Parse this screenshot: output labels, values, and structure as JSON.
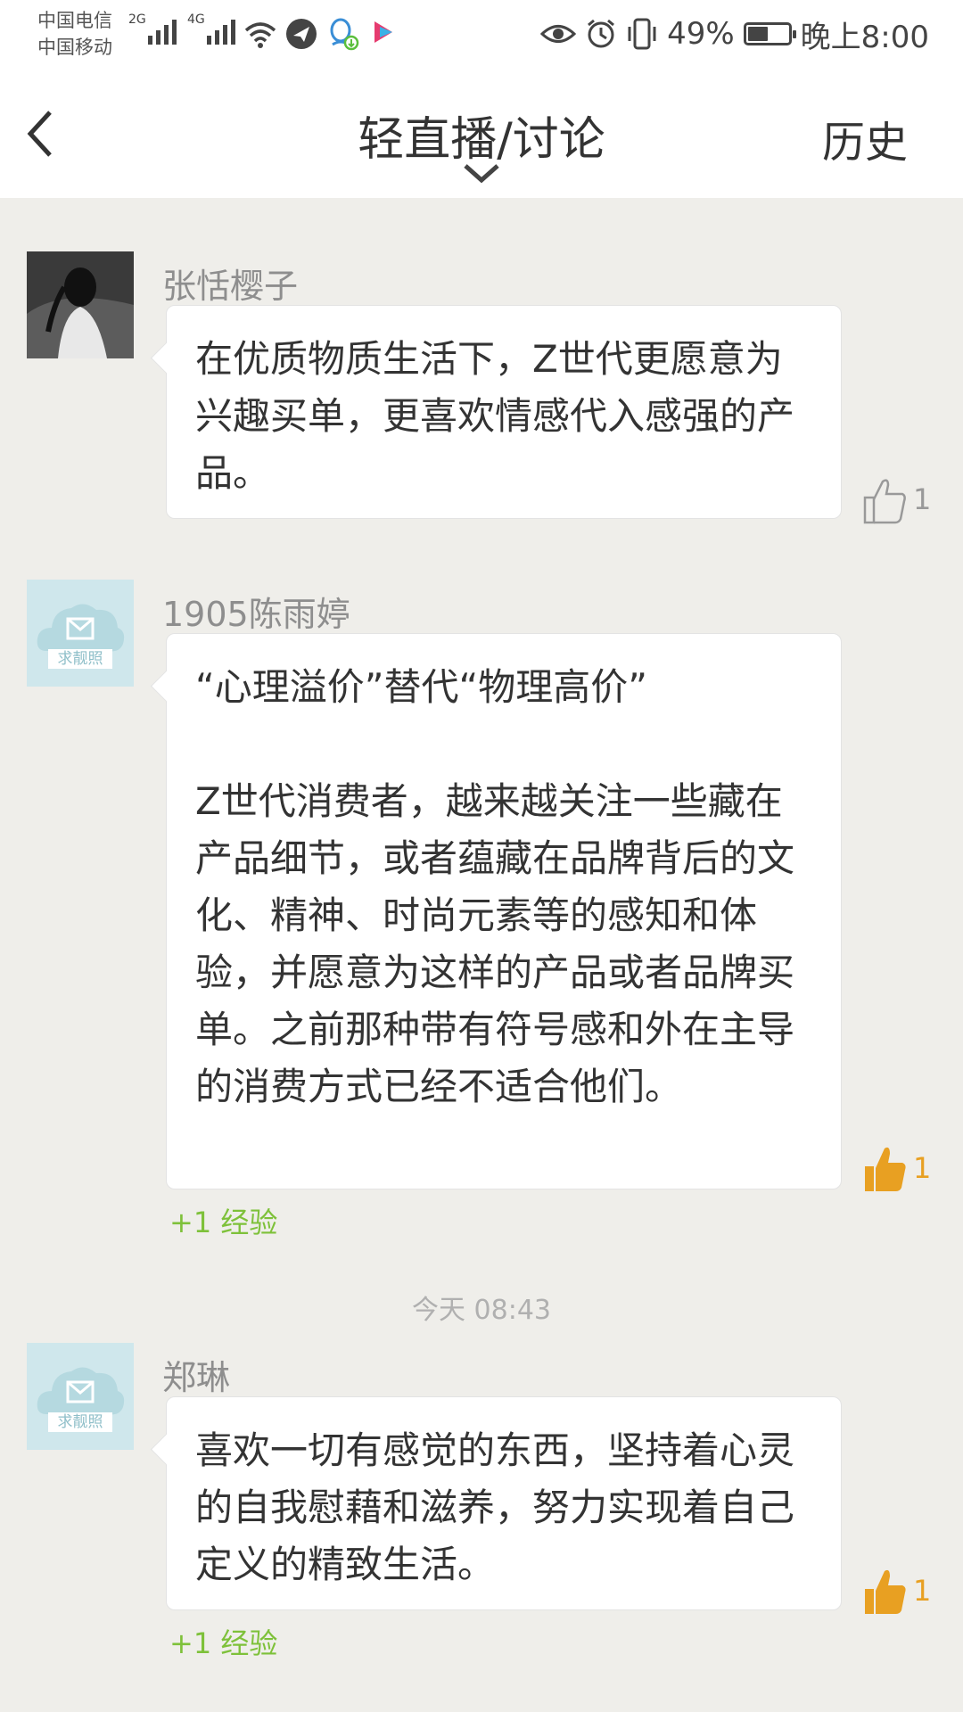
{
  "status_bar": {
    "carrier1": "中国电信",
    "carrier2": "中国移动",
    "net1": "2G",
    "net2": "4G",
    "battery_percent": "49%",
    "battery_level": 0.49,
    "time": "晚上8:00"
  },
  "nav": {
    "title": "轻直播/讨论",
    "history_label": "历史"
  },
  "messages": [
    {
      "username": "张恬樱子",
      "avatar": "photo",
      "text": "在优质物质生活下，Z世代更愿意为兴趣买单，更喜欢情感代入感强的产品。",
      "likes": "1",
      "liked": false
    },
    {
      "username": "1905陈雨婷",
      "avatar": "placeholder",
      "avatar_text": "求靓照",
      "text": "“心理溢价”替代“物理高价”\n\nZ世代消费者，越来越关注一些藏在产品细节，或者蕴藏在品牌背后的文化、精神、时尚元素等的感知和体验，并愿意为这样的产品或者品牌买单。之前那种带有符号感和外在主导的消费方式已经不适合他们。",
      "likes": "1",
      "liked": true,
      "exp": "+1 经验"
    },
    {
      "username": "郑琳",
      "avatar": "placeholder",
      "avatar_text": "求靓照",
      "text": "喜欢一切有感觉的东西，坚持着心灵的自我慰藉和滋养，努力实现着自己定义的精致生活。",
      "likes": "1",
      "liked": true,
      "exp": "+1 经验"
    }
  ],
  "timestamp": "今天 08:43",
  "colors": {
    "background": "#efeeea",
    "like_active": "#e8a022",
    "exp_green": "#7ec13a",
    "avatar_placeholder": "#cfe7ec"
  }
}
